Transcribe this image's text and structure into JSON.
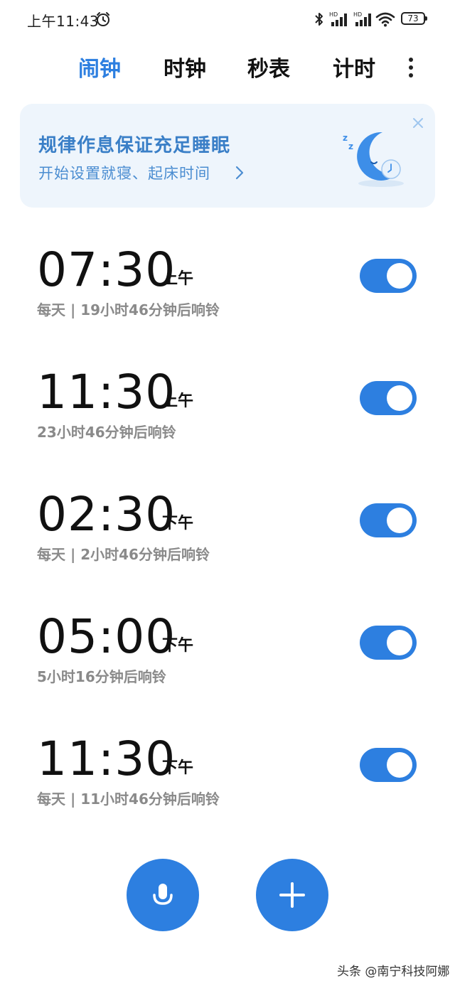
{
  "status_bar": {
    "time": "上午11:43",
    "battery": "73"
  },
  "tabs": [
    {
      "label": "闹钟",
      "active": true
    },
    {
      "label": "时钟",
      "active": false
    },
    {
      "label": "秒表",
      "active": false
    },
    {
      "label": "计时",
      "active": false
    }
  ],
  "banner": {
    "title": "规律作息保证充足睡眠",
    "subtitle": "开始设置就寝、起床时间"
  },
  "alarms": [
    {
      "time": "07:30",
      "period": "上午",
      "desc": "每天 | 19小时46分钟后响铃",
      "enabled": true
    },
    {
      "time": "11:30",
      "period": "上午",
      "desc": "23小时46分钟后响铃",
      "enabled": true
    },
    {
      "time": "02:30",
      "period": "下午",
      "desc": "每天 | 2小时46分钟后响铃",
      "enabled": true
    },
    {
      "time": "05:00",
      "period": "下午",
      "desc": "5小时16分钟后响铃",
      "enabled": true
    },
    {
      "time": "11:30",
      "period": "下午",
      "desc": "每天 | 11小时46分钟后响铃",
      "enabled": true
    }
  ],
  "watermark": "头条 @南宁科技阿娜",
  "colors": {
    "accent": "#2d7fe0",
    "banner_bg": "#eef5fc",
    "banner_text": "#3a7fc7"
  }
}
